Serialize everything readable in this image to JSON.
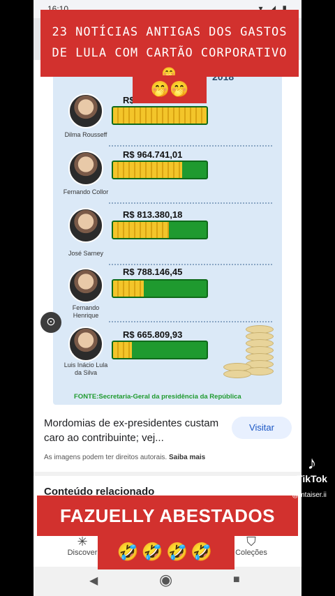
{
  "status_bar": {
    "time": "16:10",
    "icons": "▾ ◢ ▮"
  },
  "overlay": {
    "top_caption": "23 NOTÍCIAS ANTIGAS DOS GASTOS DE LULA COM CARTÃO CORPORATIVO 🤭",
    "top_emoji": "🤭🤭",
    "bottom_caption": "FAZUELLY ABESTADOS",
    "bottom_emoji": "🤣🤣🤣🤣"
  },
  "infographic": {
    "year": "2018",
    "rows": [
      {
        "name": "Dilma Rousseff",
        "amount": "R$",
        "fill": 1.0
      },
      {
        "name": "Fernando Collor",
        "amount": "R$ 964.741,01",
        "fill": 0.74
      },
      {
        "name": "José Sarney",
        "amount": "R$ 813.380,18",
        "fill": 0.6
      },
      {
        "name": "Fernando Henrique",
        "amount": "R$ 788.146,45",
        "fill": 0.33
      },
      {
        "name": "Luis Inácio Lula da Silva",
        "amount": "R$ 665.809,93",
        "fill": 0.2
      }
    ],
    "source": "FONTE:Secretaria-Geral da presidência da República"
  },
  "result": {
    "title": "Mordomias de ex-presidentes custam caro ao contribuinte; vej...",
    "visit_label": "Visitar",
    "rights_text": "As imagens podem ter direitos autorais.",
    "learn_more": "Saiba mais",
    "related_heading": "Conteúdo relacionado"
  },
  "bottom_nav": {
    "discover_label": "Discover",
    "collections_label": "Coleções"
  },
  "watermark": {
    "brand": "TikTok",
    "handle": "@mtaiser.ii"
  }
}
